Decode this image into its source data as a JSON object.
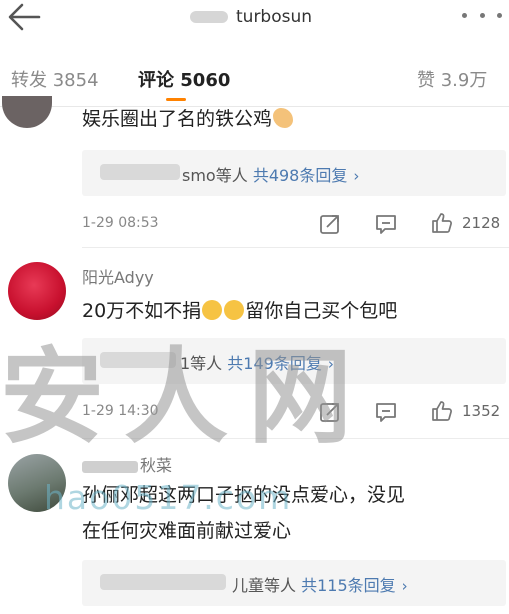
{
  "header": {
    "title": "turbosun"
  },
  "tabs": [
    {
      "label": "转发 3854"
    },
    {
      "label": "评论 5060"
    },
    {
      "label": "赞 3.9万"
    }
  ],
  "comments": [
    {
      "text": "娱乐圈出了名的铁公鸡",
      "reply_users": "smo等人",
      "reply_count": "共498条回复",
      "time": "1-29 08:53",
      "likes": "2128"
    },
    {
      "name": "阳光Adyy",
      "text": "20万不如不捐",
      "text_suffix": "留你自己买个包吧",
      "reply_users": "1等人",
      "reply_count": "共149条回复",
      "time": "1-29 14:30",
      "likes": "1352"
    },
    {
      "name": "秋菜",
      "text_line1": "孙俪邓超这两口子抠的没点爱心，没见",
      "text_line2": "在任何灾难面前献过爱心",
      "reply_users": "儿童等人",
      "reply_count": "共115条回复"
    }
  ],
  "watermark": {
    "chars": "安人网",
    "url": "hao0517.com"
  },
  "icons": {
    "back": "back-arrow-icon",
    "more": "more-dots-icon",
    "repost": "repost-icon",
    "comment": "comment-icon",
    "like": "thumbs-up-icon"
  },
  "colors": {
    "accent": "#ff8200",
    "link": "#4d7ab0"
  }
}
